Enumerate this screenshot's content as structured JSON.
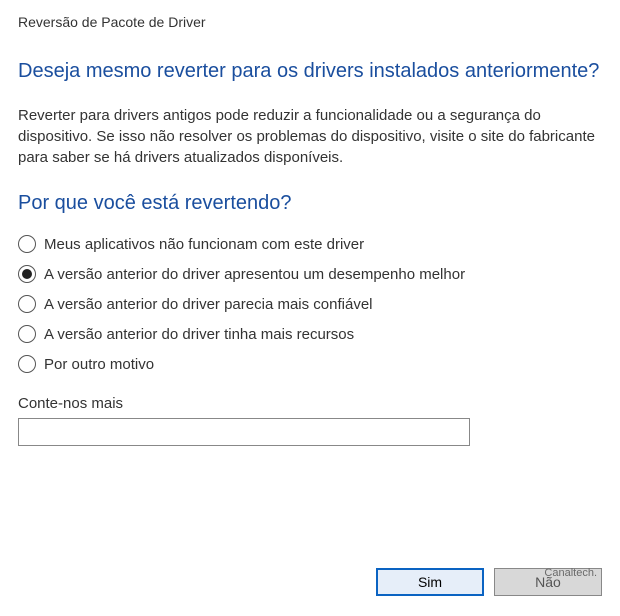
{
  "window": {
    "title": "Reversão de Pacote de Driver"
  },
  "main": {
    "heading": "Deseja mesmo reverter para os drivers instalados anteriormente?",
    "body": "Reverter para drivers antigos pode reduzir a funcionalidade ou a segurança do dispositivo. Se isso não resolver os problemas do dispositivo, visite o site do fabricante para saber se há drivers atualizados disponíveis.",
    "subheading": "Por que você está revertendo?"
  },
  "reasons": [
    {
      "label": "Meus aplicativos não funcionam com este driver",
      "selected": false
    },
    {
      "label": "A versão anterior do driver apresentou um desempenho melhor",
      "selected": true
    },
    {
      "label": "A versão anterior do driver parecia mais confiável",
      "selected": false
    },
    {
      "label": "A versão anterior do driver tinha mais recursos",
      "selected": false
    },
    {
      "label": "Por outro motivo",
      "selected": false
    }
  ],
  "tellmore": {
    "label": "Conte-nos mais",
    "value": ""
  },
  "buttons": {
    "yes": "Sim",
    "no": "Não"
  },
  "watermark": "Canaltech."
}
